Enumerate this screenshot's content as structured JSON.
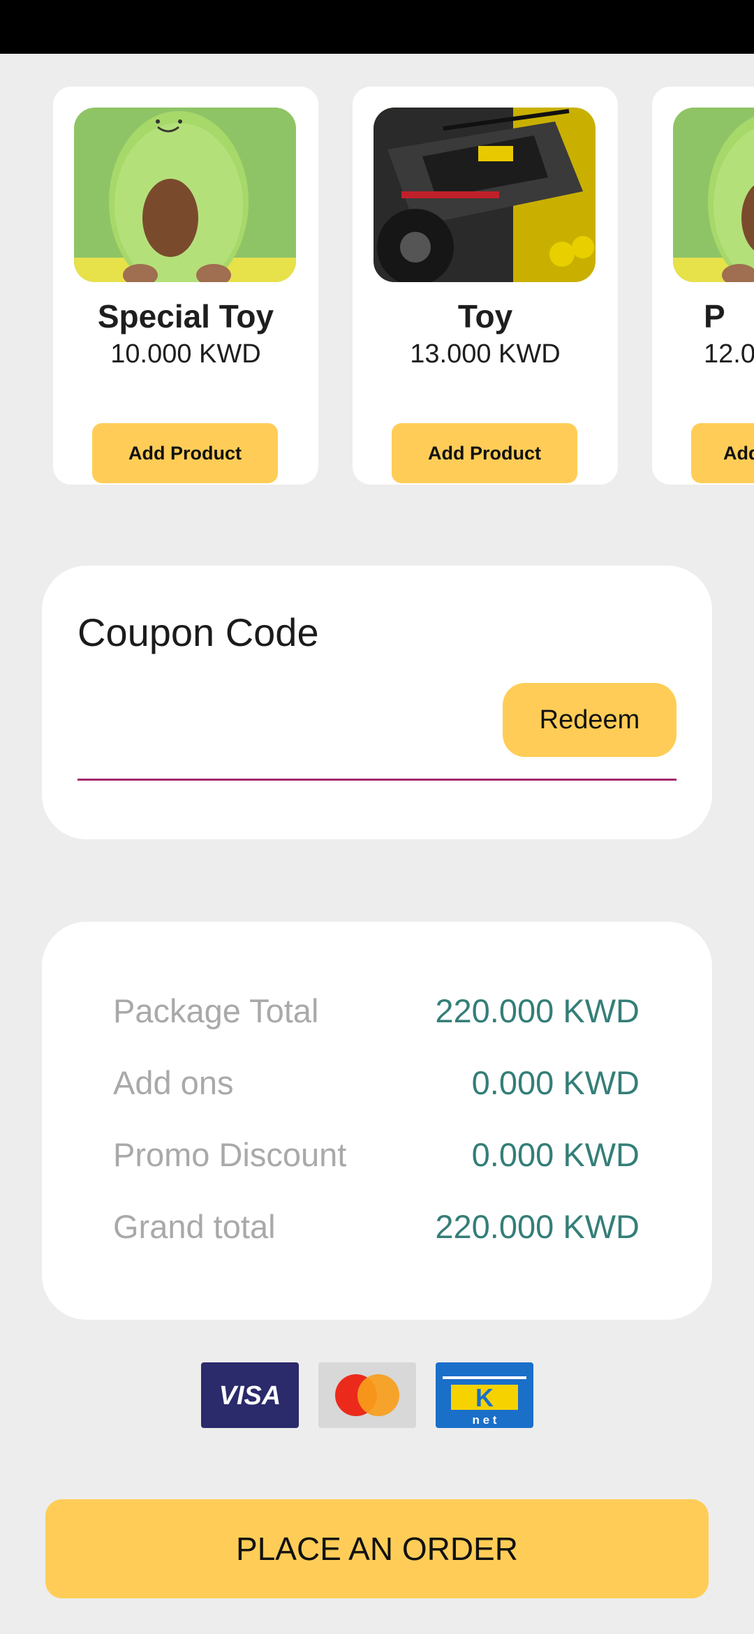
{
  "products": [
    {
      "name": "Special Toy",
      "price": "10.000 KWD",
      "button": "Add Product",
      "image": "avocado-plush"
    },
    {
      "name": "Toy",
      "price": "13.000 KWD",
      "button": "Add Product",
      "image": "lego-buggy"
    },
    {
      "name": "P",
      "price": "12.0",
      "button": "Add",
      "image": "avocado-plush"
    }
  ],
  "coupon": {
    "title": "Coupon Code",
    "value": "",
    "redeem_label": "Redeem"
  },
  "summary": [
    {
      "label": "Package Total",
      "value": "220.000 KWD"
    },
    {
      "label": "Add ons",
      "value": "0.000 KWD"
    },
    {
      "label": "Promo Discount",
      "value": "0.000 KWD"
    },
    {
      "label": "Grand total",
      "value": "220.000 KWD"
    }
  ],
  "payment_methods": [
    {
      "name": "visa-icon",
      "text": "VISA",
      "color": "#2b2a6b"
    },
    {
      "name": "mastercard-icon",
      "color": "#d8d8d8"
    },
    {
      "name": "knet-icon",
      "text": "K",
      "subtext": "n e t",
      "color": "#1a6fc9"
    }
  ],
  "place_order_label": "PLACE AN ORDER",
  "colors": {
    "accent": "#ffcd57",
    "value_teal": "#347e78",
    "label_gray": "#a9a9a9",
    "underline": "#a4286d",
    "background": "#ededed"
  }
}
